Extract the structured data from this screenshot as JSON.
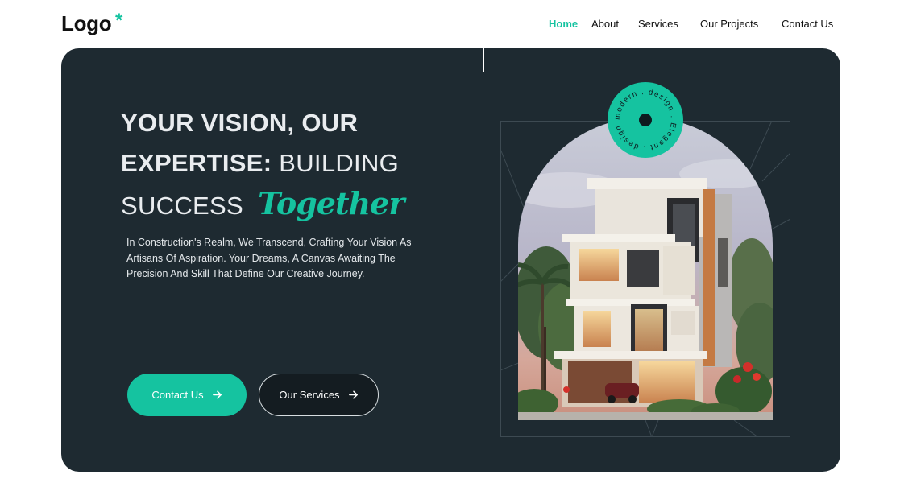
{
  "header": {
    "logo_text": "Logo",
    "logo_mark": "*",
    "nav": {
      "home": "Home",
      "about": "About",
      "services": "Services",
      "projects": "Our Projects",
      "contact": "Contact Us"
    },
    "active_item": "Home"
  },
  "hero": {
    "headline": {
      "line1": "YOUR VISION, OUR",
      "line2_bold": "EXPERTISE:",
      "line2_light": "BUILDING",
      "line3": "SUCCESS",
      "script_word": "Together"
    },
    "description": "In Construction's Realm, We Transcend, Crafting Your Vision As Artisans Of Aspiration. Your Dreams, A Canvas Awaiting The Precision And Skill That Define Our Creative Journey.",
    "primary_button": "Contact Us",
    "secondary_button": "Our Services",
    "badge_text": "modern . design . Elegant . design .",
    "image_subject": "modern-house-illustration"
  },
  "colors": {
    "accent": "#15c3a0",
    "hero_background": "#1e2a31",
    "text_dark": "#111111",
    "text_light": "#e9ecef"
  }
}
